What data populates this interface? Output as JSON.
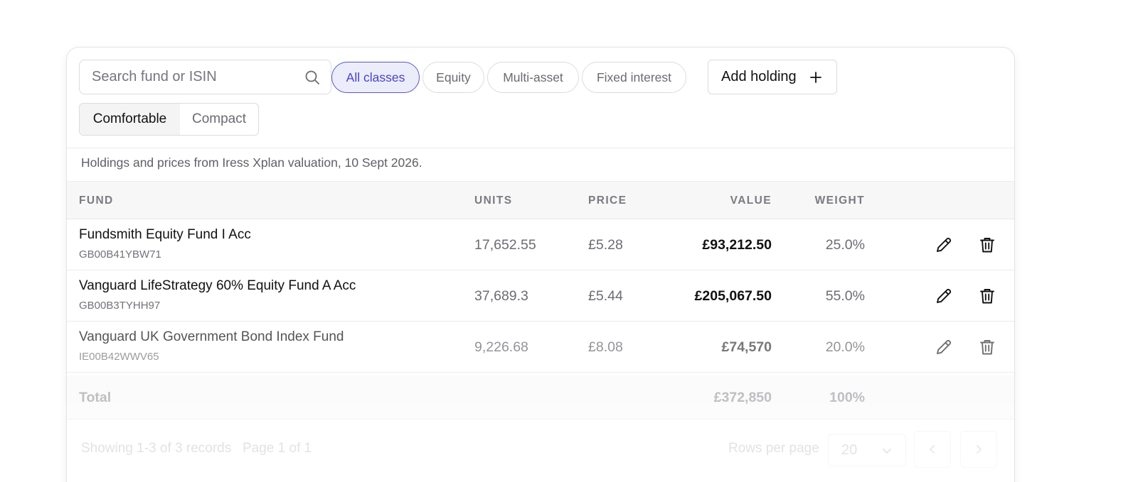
{
  "toolbar": {
    "search_placeholder": "Search fund or ISIN",
    "filters": [
      "All classes",
      "Equity",
      "Multi-asset",
      "Fixed interest"
    ],
    "active_filter": "All classes",
    "add_label": "Add holding",
    "density": {
      "options": [
        "Comfortable",
        "Compact"
      ],
      "selected": "Comfortable"
    }
  },
  "source_note": "Holdings and prices from Iress Xplan valuation, 10 Sept 2026.",
  "table": {
    "headers": {
      "fund": "FUND",
      "units": "UNITS",
      "price": "PRICE",
      "value": "VALUE",
      "weight": "WEIGHT"
    },
    "rows": [
      {
        "name": "Fundsmith Equity Fund I Acc",
        "isin": "GB00B41YBW71",
        "units": "17,652.55",
        "price": "£5.28",
        "value": "£93,212.50",
        "weight": "25.0%"
      },
      {
        "name": "Vanguard LifeStrategy 60% Equity Fund A Acc",
        "isin": "GB00B3TYHH97",
        "units": "37,689.3",
        "price": "£5.44",
        "value": "£205,067.50",
        "weight": "55.0%"
      },
      {
        "name": "Vanguard UK Government Bond Index Fund",
        "isin": "IE00B42WWV65",
        "units": "9,226.68",
        "price": "£8.08",
        "value": "£74,570",
        "weight": "20.0%"
      }
    ],
    "total": {
      "label": "Total",
      "value": "£372,850",
      "weight": "100%"
    }
  },
  "footer": {
    "showing": "Showing 1-3 of 3 records",
    "page": "Page 1 of 1",
    "rows_per_page_label": "Rows per page",
    "rows_per_page": "20"
  },
  "colors": {
    "accent": "#4a44c6",
    "accent_bg": "#ecedfb"
  },
  "icons": {
    "search": "search-icon",
    "add": "plus-icon",
    "edit": "pencil-icon",
    "delete": "trash-icon"
  }
}
